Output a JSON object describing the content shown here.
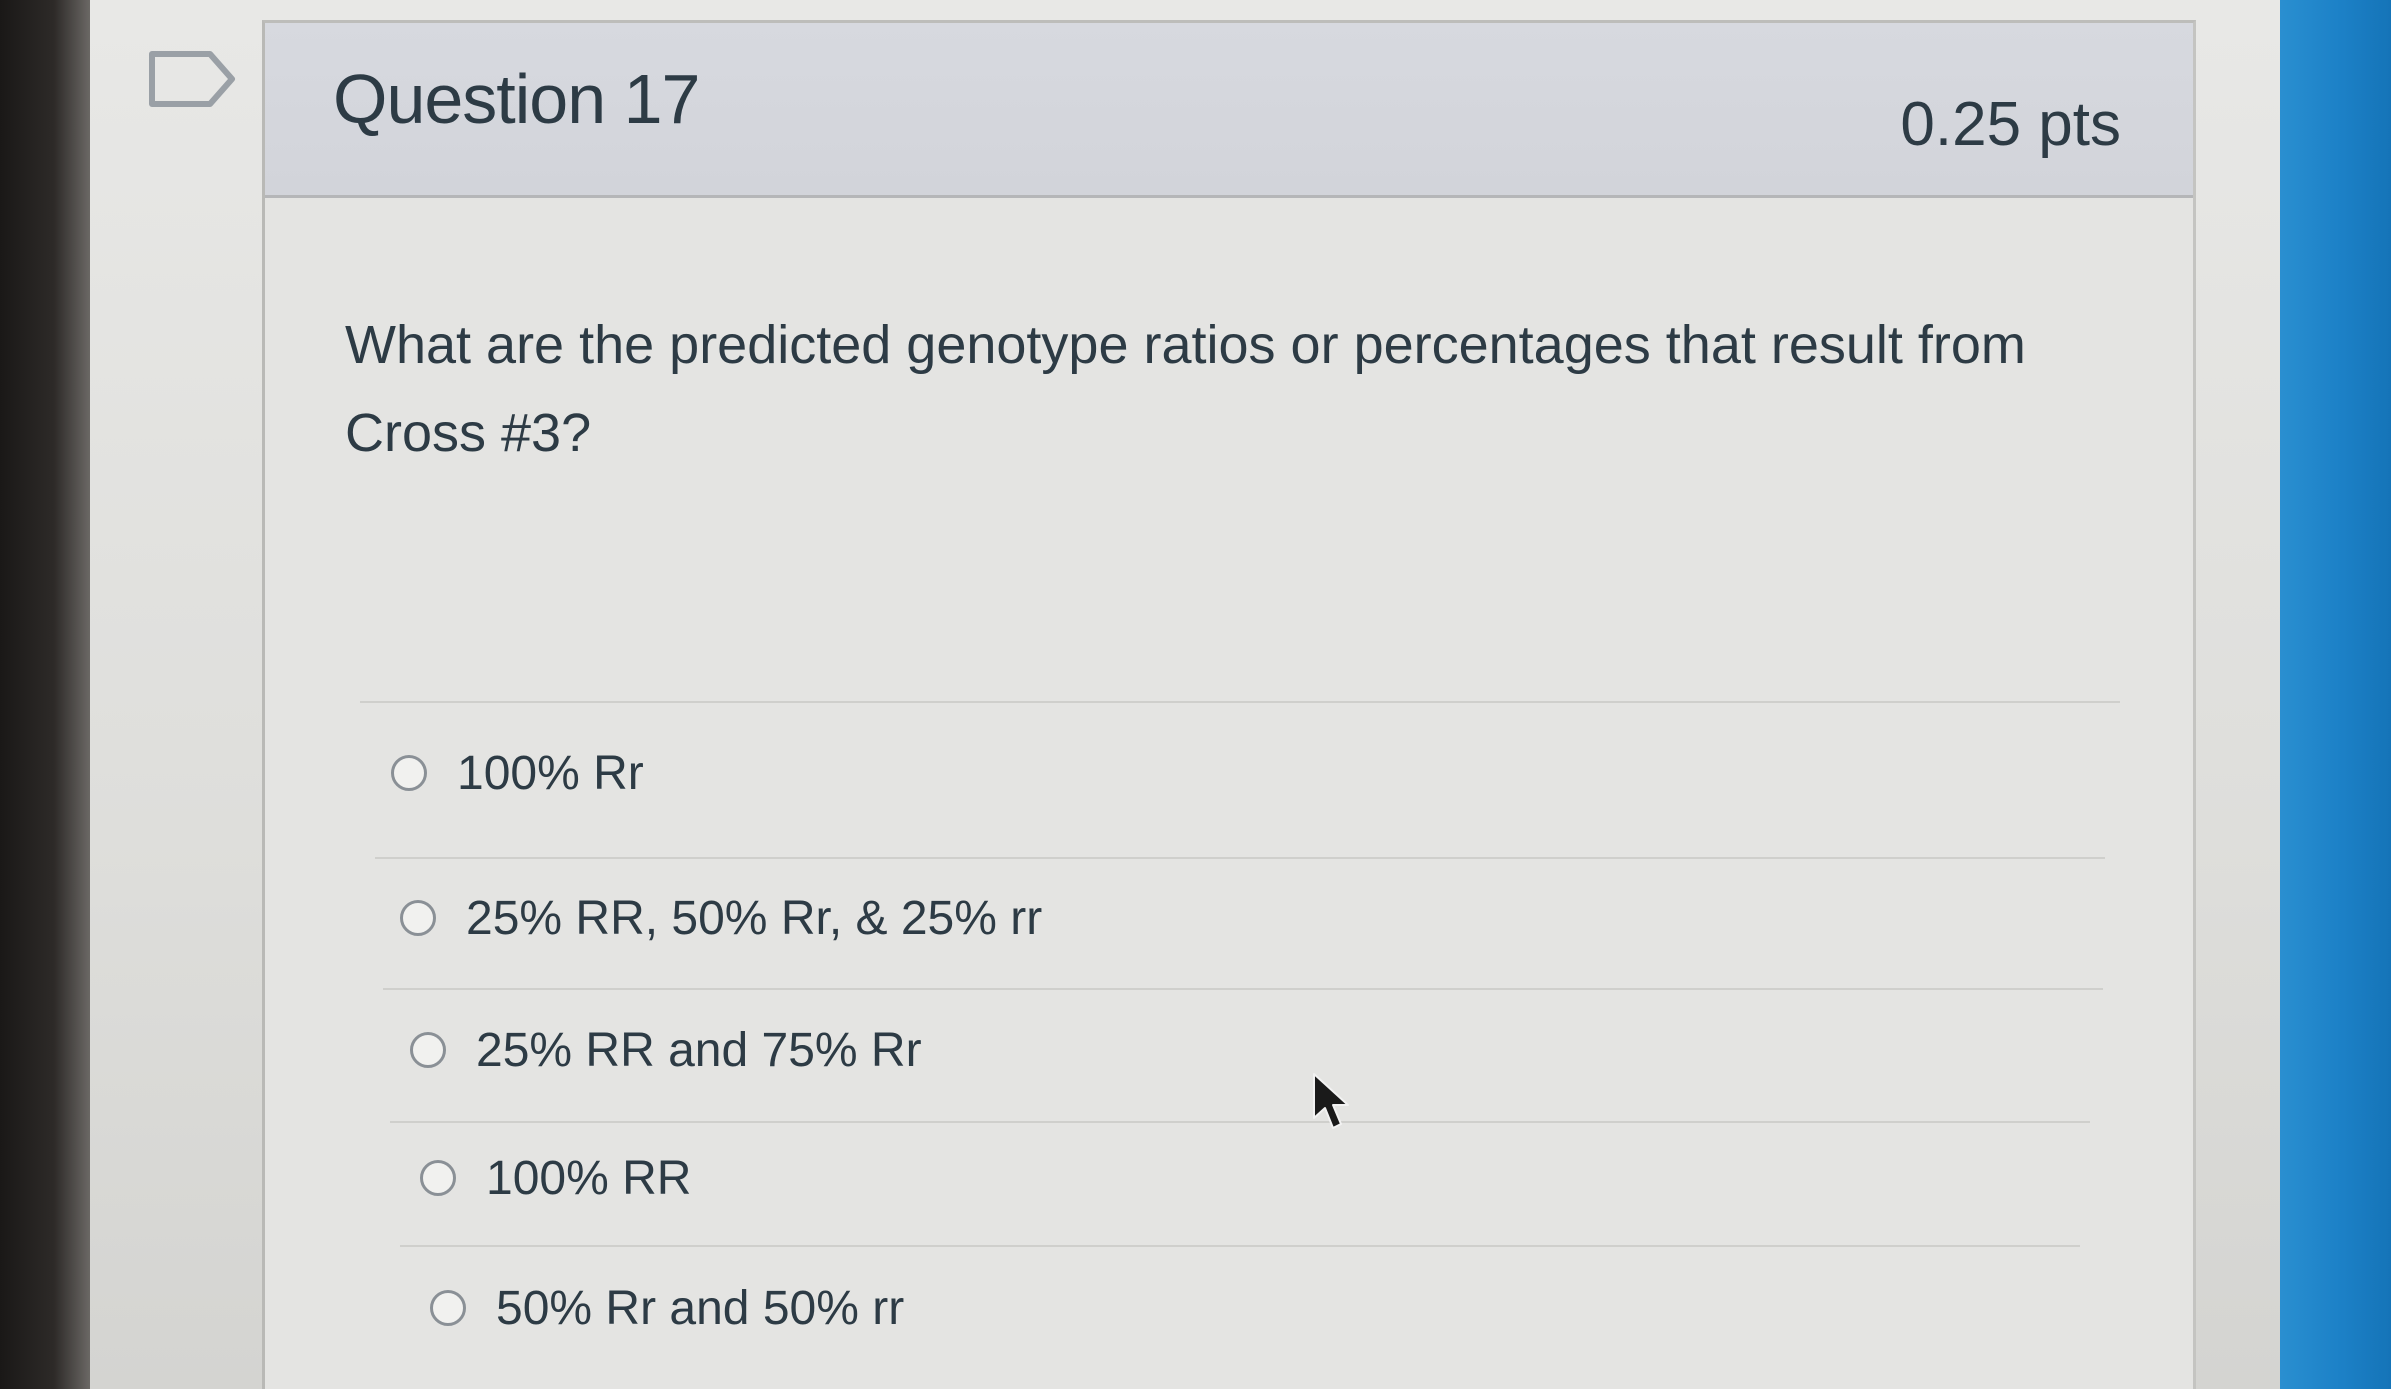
{
  "question": {
    "title": "Question 17",
    "points": "0.25 pts",
    "text": "What are the predicted genotype ratios or percentages that result from Cross #3?"
  },
  "answers": [
    {
      "label": "100% Rr",
      "selected": false
    },
    {
      "label": "25% RR, 50% Rr, & 25% rr",
      "selected": false
    },
    {
      "label": "25% RR and 75% Rr",
      "selected": false
    },
    {
      "label": "100% RR",
      "selected": false
    },
    {
      "label": "50% Rr and 50% rr",
      "selected": false
    }
  ],
  "icons": {
    "flag": "flag-question-icon",
    "cursor": "mouse-pointer-icon"
  },
  "colors": {
    "text": "#2d3b45",
    "header_bg": "#d7d9df",
    "accent_strip": "#1d82c8"
  }
}
